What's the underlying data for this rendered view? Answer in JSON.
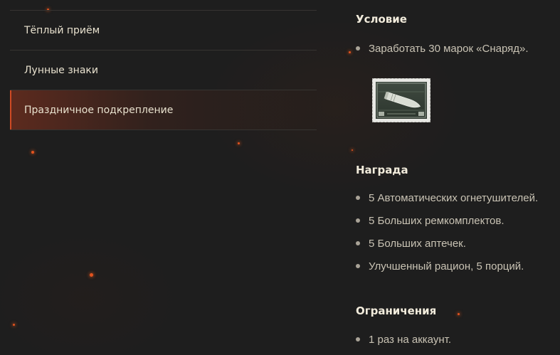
{
  "menu": {
    "items": [
      {
        "label": "Тёплый приём",
        "active": false
      },
      {
        "label": "Лунные знаки",
        "active": false
      },
      {
        "label": "Праздничное подкрепление",
        "active": true
      }
    ]
  },
  "condition": {
    "title": "Условие",
    "items": [
      "Заработать 30 марок «Снаряд»."
    ],
    "stamp_icon": "shell-stamp-icon"
  },
  "reward": {
    "title": "Награда",
    "items": [
      "5 Автоматических огнетушителей.",
      "5 Больших ремкомплектов.",
      "5 Больших аптечек.",
      "Улучшенный рацион, 5 порций."
    ]
  },
  "limits": {
    "title": "Ограничения",
    "items": [
      "1 раз на аккаунт."
    ]
  },
  "colors": {
    "background": "#1e1e1e",
    "accent": "#cf4a24",
    "heading": "#f2ecdc",
    "text": "#c9c3b4"
  }
}
